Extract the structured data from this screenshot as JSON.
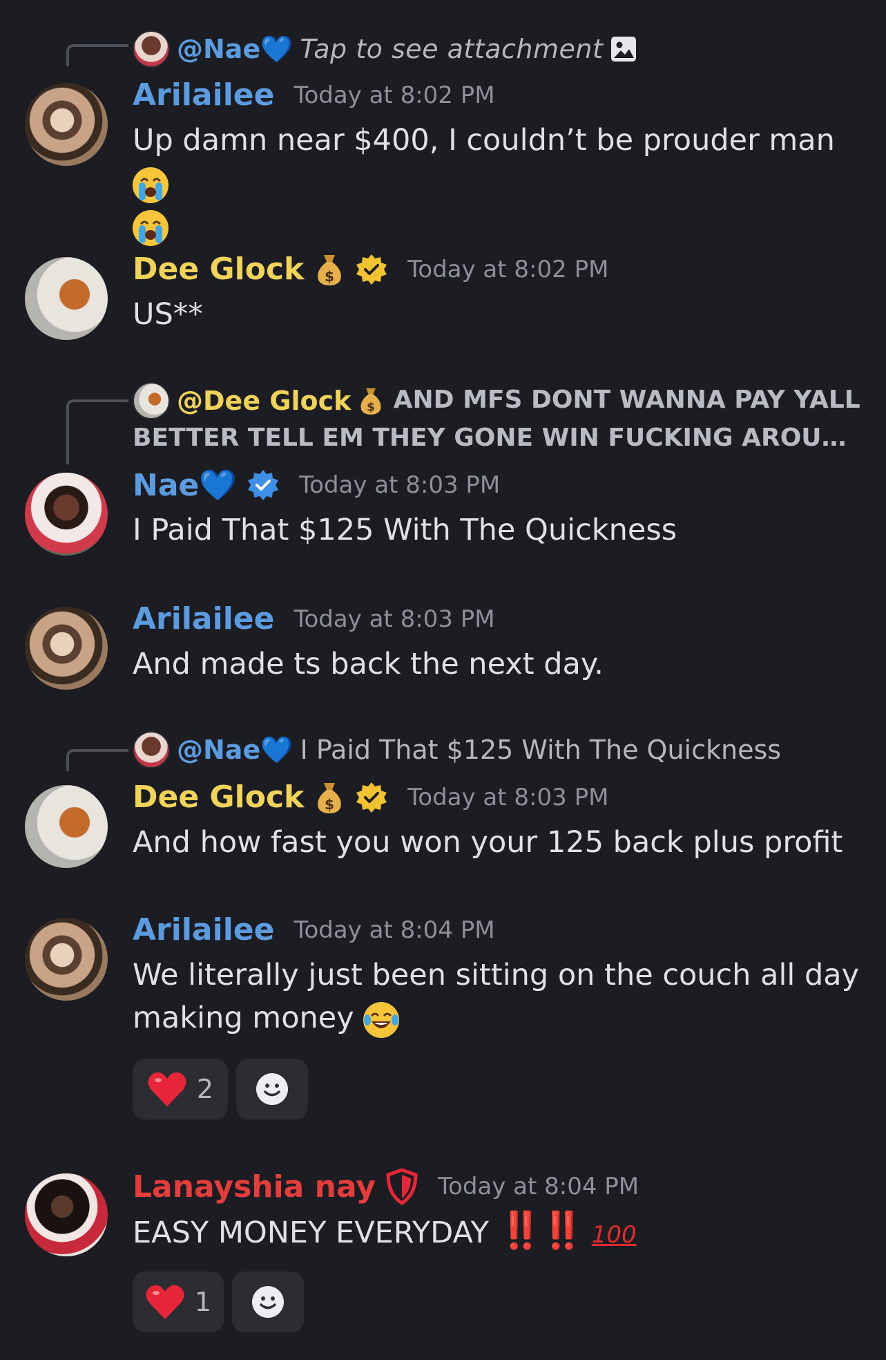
{
  "messages": [
    {
      "reply": {
        "name": "@Nae💙",
        "text": "Tap to see attachment"
      },
      "author": "Arilailee",
      "time": "Today at 8:02 PM",
      "text": "Up damn near $400, I couldn’t be prouder man"
    },
    {
      "author": "Dee Glock",
      "time": "Today at 8:02 PM",
      "text": "US**"
    },
    {
      "reply": {
        "name": "@Dee Glock",
        "text": "AND MFS DONT WANNA PAY YALL BETTER TELL EM THEY GONE WIN FUCKING AROU…"
      },
      "author": "Nae💙",
      "time": "Today at 8:03 PM",
      "text": "I Paid That $125 With The Quickness"
    },
    {
      "author": "Arilailee",
      "time": "Today at 8:03 PM",
      "text": "And made ts back the next day."
    },
    {
      "reply": {
        "name": "@Nae💙",
        "text": "I Paid That $125 With The Quickness"
      },
      "author": "Dee Glock",
      "time": "Today at 8:03 PM",
      "text": "And how fast you won your 125 back plus profit"
    },
    {
      "author": "Arilailee",
      "time": "Today at 8:04 PM",
      "text": "We literally just been sitting on the couch all day making money",
      "reaction_count": "2"
    },
    {
      "author": "Lanayshia nay",
      "time": "Today at 8:04 PM",
      "text": "EASY MONEY EVERYDAY",
      "emphasis": "‼️‼️",
      "hundred": "100",
      "reaction_count": "1"
    }
  ],
  "colors": {
    "background": "#1c1d22",
    "arilailee": "#5b9be0",
    "dee_glock": "#f1d35a",
    "nae": "#5b9be0",
    "lanayshia": "#e53c3c",
    "timestamp": "#8d9098",
    "reaction_bg": "#2b2d33"
  },
  "icons": [
    "image-attachment-icon",
    "money-bag-icon",
    "verified-gold-icon",
    "verified-blue-icon",
    "blue-heart-icon",
    "shield-icon",
    "heart-reaction-icon",
    "add-reaction-icon"
  ]
}
